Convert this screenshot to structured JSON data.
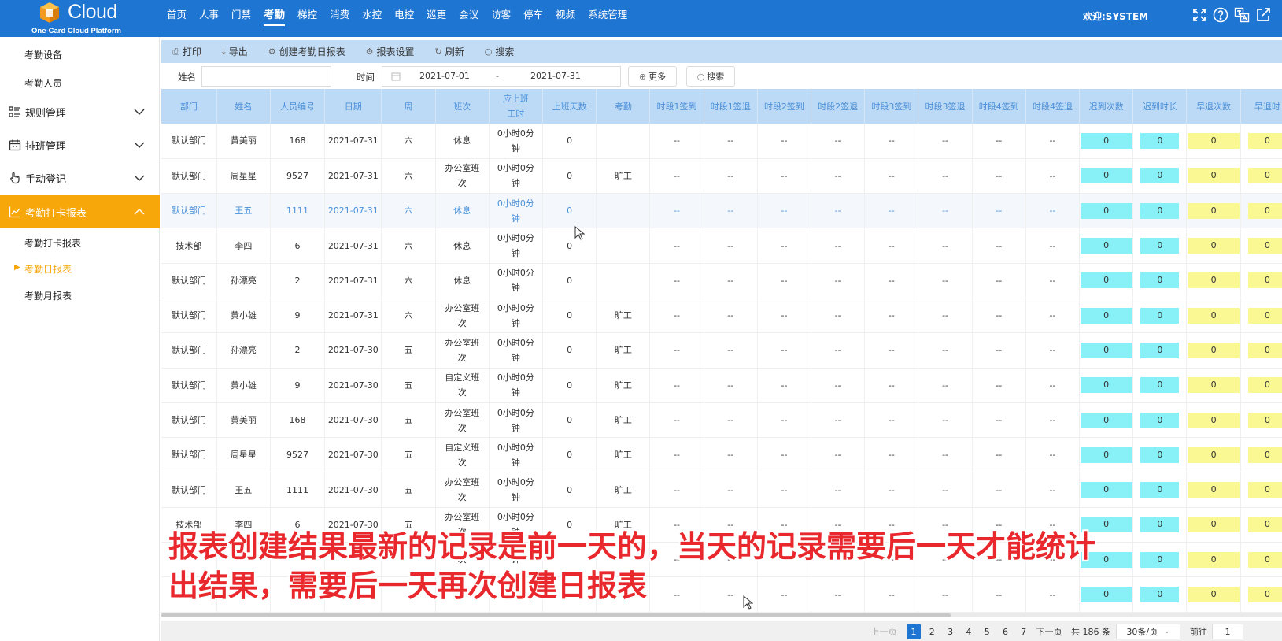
{
  "app": {
    "logo_text": "Cloud",
    "logo_sub": "One-Card Cloud Platform",
    "welcome": "欢迎:SYSTEM"
  },
  "nav": {
    "items": [
      "首页",
      "人事",
      "门禁",
      "考勤",
      "梯控",
      "消费",
      "水控",
      "电控",
      "巡更",
      "会议",
      "访客",
      "停车",
      "视频",
      "系统管理"
    ],
    "active": "考勤"
  },
  "top_icons": [
    "fullscreen-icon",
    "help-icon",
    "language-icon",
    "external-link-icon"
  ],
  "sidebar": {
    "top_items": [
      "考勤设备",
      "考勤人员"
    ],
    "groups": [
      {
        "label": "规则管理",
        "icon": "rules-list-icon"
      },
      {
        "label": "排班管理",
        "icon": "calendar-icon"
      },
      {
        "label": "手动登记",
        "icon": "hand-pointer-icon"
      },
      {
        "label": "考勤打卡报表",
        "icon": "chart-icon"
      }
    ],
    "sub_items": [
      "考勤打卡报表",
      "考勤日报表",
      "考勤月报表"
    ],
    "current": "考勤日报表",
    "active_color": "#f7a70a"
  },
  "toolbar": {
    "print": "打印",
    "export": "导出",
    "create": "创建考勤日报表",
    "settings": "报表设置",
    "refresh": "刷新",
    "search": "搜索"
  },
  "filters": {
    "name_label": "姓名",
    "name_value": "",
    "time_label": "时间",
    "date_start": "2021-07-01",
    "date_sep": "-",
    "date_end": "2021-07-31",
    "more": "更多",
    "search": "搜索"
  },
  "table": {
    "columns": [
      "部门",
      "姓名",
      "人员编号",
      "日期",
      "周",
      "班次",
      "应上班工时",
      "上班天数",
      "考勤",
      "时段1签到",
      "时段1签退",
      "时段2签到",
      "时段2签退",
      "时段3签到",
      "时段3签退",
      "时段4签到",
      "时段4签退",
      "迟到次数",
      "迟到时长",
      "早退次数",
      "早退时"
    ],
    "rows": [
      {
        "dept": "默认部门",
        "name": "黄美丽",
        "id": "168",
        "date": "2021-07-31",
        "week": "六",
        "shift": "休息",
        "hours": "0小时0分钟",
        "days": "0",
        "status": "",
        "hl": false
      },
      {
        "dept": "默认部门",
        "name": "周星星",
        "id": "9527",
        "date": "2021-07-31",
        "week": "六",
        "shift": "办公室班次",
        "hours": "0小时0分钟",
        "days": "0",
        "status": "旷工",
        "hl": false
      },
      {
        "dept": "默认部门",
        "name": "王五",
        "id": "1111",
        "date": "2021-07-31",
        "week": "六",
        "shift": "休息",
        "hours": "0小时0分钟",
        "days": "0",
        "status": "",
        "hl": true
      },
      {
        "dept": "技术部",
        "name": "李四",
        "id": "6",
        "date": "2021-07-31",
        "week": "六",
        "shift": "休息",
        "hours": "0小时0分钟",
        "days": "0",
        "status": "",
        "hl": false
      },
      {
        "dept": "默认部门",
        "name": "孙漂亮",
        "id": "2",
        "date": "2021-07-31",
        "week": "六",
        "shift": "休息",
        "hours": "0小时0分钟",
        "days": "0",
        "status": "",
        "hl": false
      },
      {
        "dept": "默认部门",
        "name": "黄小雄",
        "id": "9",
        "date": "2021-07-31",
        "week": "六",
        "shift": "办公室班次",
        "hours": "0小时0分钟",
        "days": "0",
        "status": "旷工",
        "hl": false
      },
      {
        "dept": "默认部门",
        "name": "孙漂亮",
        "id": "2",
        "date": "2021-07-30",
        "week": "五",
        "shift": "办公室班次",
        "hours": "0小时0分钟",
        "days": "0",
        "status": "旷工",
        "hl": false
      },
      {
        "dept": "默认部门",
        "name": "黄小雄",
        "id": "9",
        "date": "2021-07-30",
        "week": "五",
        "shift": "自定义班次",
        "hours": "0小时0分钟",
        "days": "0",
        "status": "旷工",
        "hl": false
      },
      {
        "dept": "默认部门",
        "name": "黄美丽",
        "id": "168",
        "date": "2021-07-30",
        "week": "五",
        "shift": "办公室班次",
        "hours": "0小时0分钟",
        "days": "0",
        "status": "旷工",
        "hl": false
      },
      {
        "dept": "默认部门",
        "name": "周星星",
        "id": "9527",
        "date": "2021-07-30",
        "week": "五",
        "shift": "自定义班次",
        "hours": "0小时0分钟",
        "days": "0",
        "status": "旷工",
        "hl": false
      },
      {
        "dept": "默认部门",
        "name": "王五",
        "id": "1111",
        "date": "2021-07-30",
        "week": "五",
        "shift": "办公室班次",
        "hours": "0小时0分钟",
        "days": "0",
        "status": "旷工",
        "hl": false
      },
      {
        "dept": "技术部",
        "name": "李四",
        "id": "6",
        "date": "2021-07-30",
        "week": "五",
        "shift": "办公室班次",
        "hours": "0小时0分钟",
        "days": "0",
        "status": "旷工",
        "hl": false
      },
      {
        "dept": "",
        "name": "",
        "id": "",
        "date": "",
        "week": "",
        "shift": "次",
        "hours": "钟",
        "days": "",
        "status": "",
        "hl": false
      },
      {
        "dept": "",
        "name": "",
        "id": "2",
        "date": "",
        "week": "",
        "shift": "",
        "hours": "",
        "days": "",
        "status": "",
        "hl": false
      }
    ],
    "empty_cell": "--",
    "count_value": "0",
    "late_color": "#88f0f7",
    "early_color": "#faf893"
  },
  "pager": {
    "prev": "上一页",
    "pages": [
      "1",
      "2",
      "3",
      "4",
      "5",
      "6",
      "7"
    ],
    "current": "1",
    "next": "下一页",
    "total": "共 186 条",
    "per_page": "30条/页",
    "goto": "前往",
    "goto_value": "1"
  },
  "caption": {
    "line1": "报表创建结果最新的记录是前一天的，当天的记录需要后一天才能统计",
    "line2": "出结果，需要后一天再次创建日报表"
  }
}
